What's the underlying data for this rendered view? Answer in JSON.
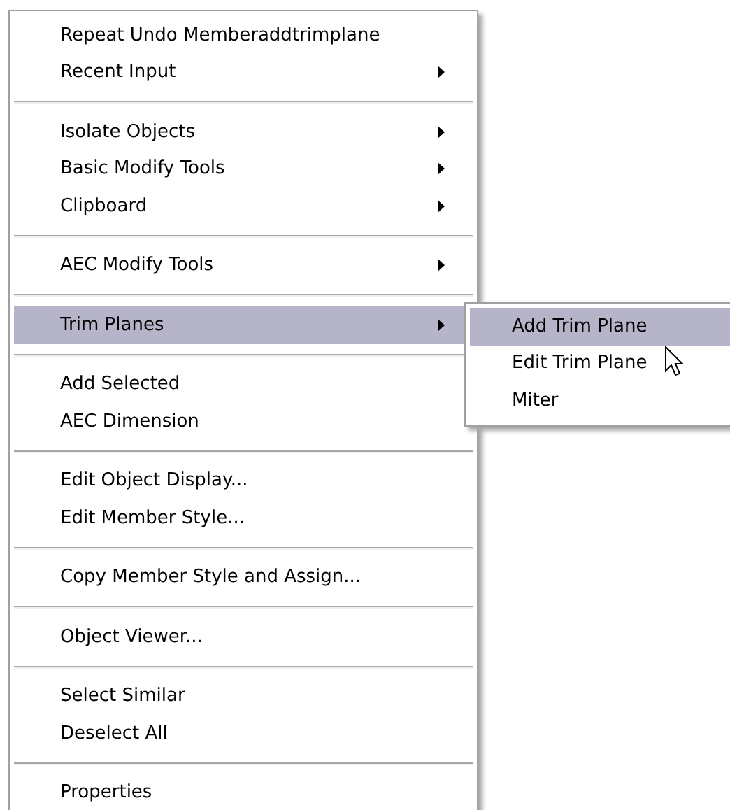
{
  "context_menu": {
    "items": [
      {
        "kind": "item",
        "label": "Repeat Undo Memberaddtrimplane",
        "has_submenu": false,
        "selected": false
      },
      {
        "kind": "item",
        "label": "Recent Input",
        "has_submenu": true,
        "selected": false
      },
      {
        "kind": "separator"
      },
      {
        "kind": "item",
        "label": "Isolate Objects",
        "has_submenu": true,
        "selected": false
      },
      {
        "kind": "item",
        "label": "Basic Modify Tools",
        "has_submenu": true,
        "selected": false
      },
      {
        "kind": "item",
        "label": "Clipboard",
        "has_submenu": true,
        "selected": false
      },
      {
        "kind": "separator"
      },
      {
        "kind": "item",
        "label": "AEC Modify Tools",
        "has_submenu": true,
        "selected": false
      },
      {
        "kind": "separator"
      },
      {
        "kind": "item",
        "label": "Trim Planes",
        "has_submenu": true,
        "selected": true
      },
      {
        "kind": "separator"
      },
      {
        "kind": "item",
        "label": "Add Selected",
        "has_submenu": false,
        "selected": false
      },
      {
        "kind": "item",
        "label": "AEC Dimension",
        "has_submenu": false,
        "selected": false
      },
      {
        "kind": "separator"
      },
      {
        "kind": "item",
        "label": "Edit Object Display...",
        "has_submenu": false,
        "selected": false
      },
      {
        "kind": "item",
        "label": "Edit Member Style...",
        "has_submenu": false,
        "selected": false
      },
      {
        "kind": "separator"
      },
      {
        "kind": "item",
        "label": "Copy Member Style and Assign...",
        "has_submenu": false,
        "selected": false
      },
      {
        "kind": "separator"
      },
      {
        "kind": "item",
        "label": "Object Viewer...",
        "has_submenu": false,
        "selected": false
      },
      {
        "kind": "separator"
      },
      {
        "kind": "item",
        "label": "Select Similar",
        "has_submenu": false,
        "selected": false
      },
      {
        "kind": "item",
        "label": "Deselect All",
        "has_submenu": false,
        "selected": false
      },
      {
        "kind": "separator"
      },
      {
        "kind": "item",
        "label": "Properties",
        "has_submenu": false,
        "selected": false
      }
    ]
  },
  "submenu": {
    "items": [
      {
        "label": "Add Trim Plane",
        "selected": true
      },
      {
        "label": "Edit Trim Plane",
        "selected": false
      },
      {
        "label": "Miter",
        "selected": false
      }
    ]
  }
}
